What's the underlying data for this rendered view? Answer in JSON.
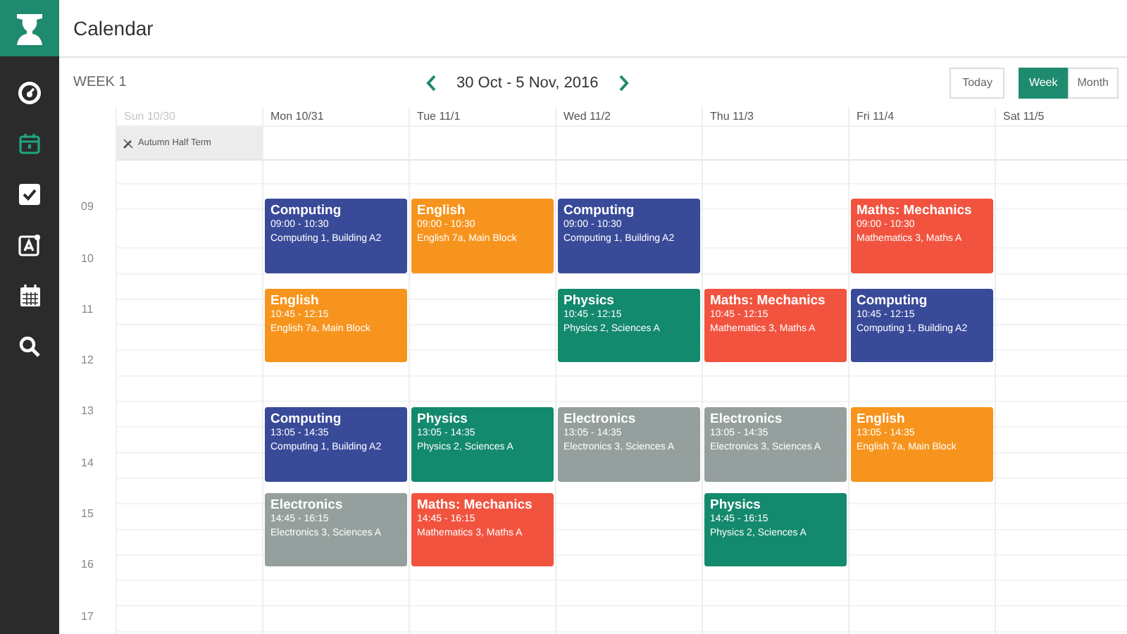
{
  "app_bar": {
    "title": "Calendar"
  },
  "sidebar": {
    "items": [
      {
        "kind": "dashboard",
        "selected": false
      },
      {
        "kind": "calendar",
        "selected": true
      },
      {
        "kind": "tasks",
        "selected": false
      },
      {
        "kind": "grades",
        "selected": false
      },
      {
        "kind": "timetable",
        "selected": false
      },
      {
        "kind": "search",
        "selected": false
      }
    ]
  },
  "toolbar": {
    "week_label": "WEEK 1",
    "range": "30 Oct - 5 Nov, 2016",
    "today": "Today",
    "views": [
      {
        "label": "Week",
        "selected": true
      },
      {
        "label": "Month",
        "selected": false
      }
    ]
  },
  "hours": [
    "09",
    "10",
    "11",
    "12",
    "13",
    "14",
    "15",
    "16",
    "17"
  ],
  "days": [
    {
      "label": "Sun 10/30",
      "muted": true,
      "all_day": "Autumn Half Term"
    },
    {
      "label": "Mon 10/31",
      "muted": false,
      "events": [
        {
          "title": "Computing",
          "time": "09:00 - 10:30",
          "room": "Computing 1, Building A2",
          "color": "#394a99"
        },
        {
          "title": "English",
          "time": "10:45 - 12:15",
          "room": "English 7a, Main Block",
          "color": "#f7941d"
        },
        {
          "title": "Computing",
          "time": "13:05 - 14:35",
          "room": "Computing 1, Building A2",
          "color": "#394a99"
        },
        {
          "title": "Electronics",
          "time": "14:45 - 16:15",
          "room": "Electronics 3, Sciences A",
          "color": "#95a09e"
        }
      ]
    },
    {
      "label": "Tue 11/1",
      "muted": false,
      "events": [
        {
          "title": "English",
          "time": "09:00 - 10:30",
          "room": "English 7a, Main Block",
          "color": "#f7941d"
        },
        {
          "title": "Physics",
          "time": "13:05 - 14:35",
          "room": "Physics 2, Sciences A",
          "color": "#13896d"
        },
        {
          "title": "Maths: Mechanics",
          "time": "14:45 - 16:15",
          "room": "Mathematics 3, Maths A",
          "color": "#f1533f"
        }
      ]
    },
    {
      "label": "Wed 11/2",
      "muted": false,
      "events": [
        {
          "title": "Computing",
          "time": "09:00 - 10:30",
          "room": "Computing 1, Building A2",
          "color": "#394a99"
        },
        {
          "title": "Physics",
          "time": "10:45 - 12:15",
          "room": "Physics 2, Sciences A",
          "color": "#13896d"
        },
        {
          "title": "Electronics",
          "time": "13:05 - 14:35",
          "room": "Electronics 3, Sciences A",
          "color": "#95a09e"
        }
      ]
    },
    {
      "label": "Thu 11/3",
      "muted": false,
      "events": [
        {
          "title": "Maths: Mechanics",
          "time": "10:45 - 12:15",
          "room": "Mathematics 3, Maths A",
          "color": "#f1533f"
        },
        {
          "title": "Electronics",
          "time": "13:05 - 14:35",
          "room": "Electronics 3, Sciences A",
          "color": "#95a09e"
        },
        {
          "title": "Physics",
          "time": "14:45 - 16:15",
          "room": "Physics 2, Sciences A",
          "color": "#13896d"
        }
      ]
    },
    {
      "label": "Fri 11/4",
      "muted": false,
      "events": [
        {
          "title": "Maths: Mechanics",
          "time": "09:00 - 10:30",
          "room": "Mathematics 3, Maths A",
          "color": "#f1533f"
        },
        {
          "title": "Computing",
          "time": "10:45 - 12:15",
          "room": "Computing 1, Building A2",
          "color": "#394a99"
        },
        {
          "title": "English",
          "time": "13:05 - 14:35",
          "room": "English 7a, Main Block",
          "color": "#f7941d"
        }
      ]
    },
    {
      "label": "Sat 11/5",
      "muted": false
    }
  ]
}
